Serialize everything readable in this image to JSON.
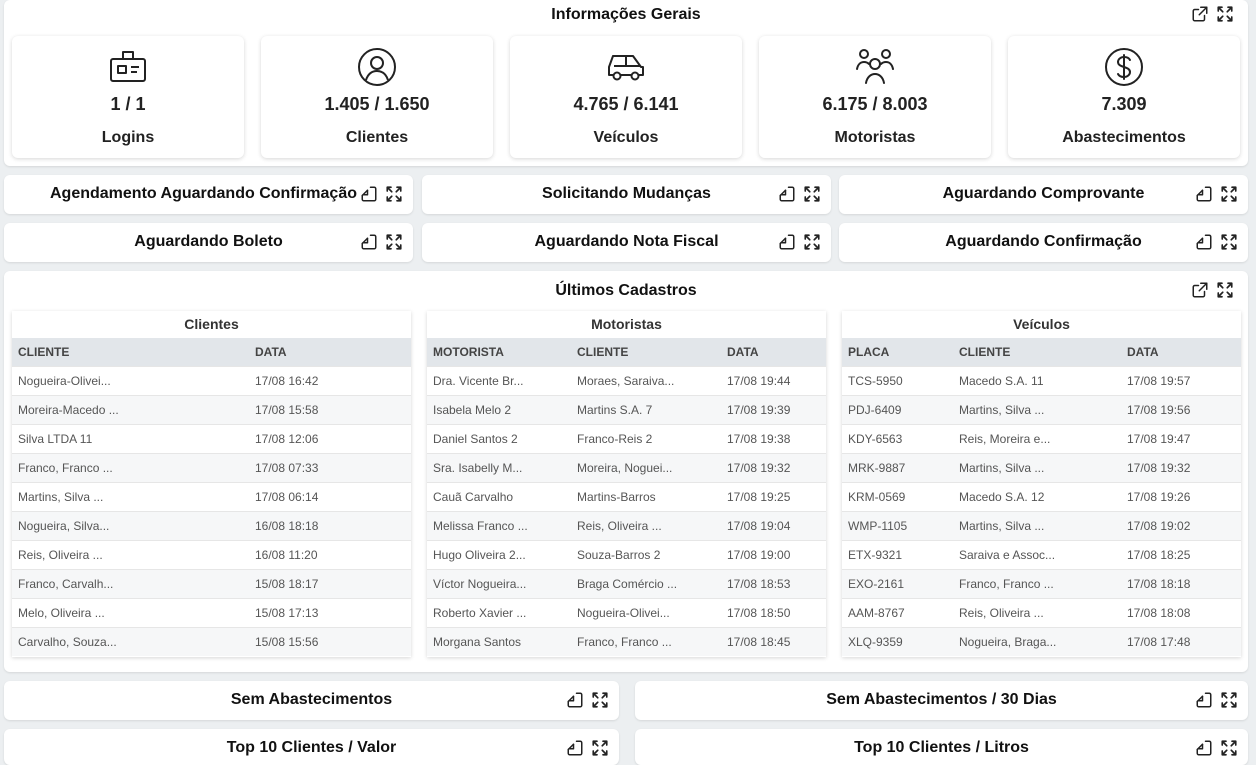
{
  "general": {
    "title": "Informações Gerais",
    "cards": [
      {
        "icon": "id-badge-icon",
        "value": "1 / 1",
        "label": "Logins"
      },
      {
        "icon": "user-circle-icon",
        "value": "1.405 / 1.650",
        "label": "Clientes"
      },
      {
        "icon": "car-icon",
        "value": "4.765 / 6.141",
        "label": "Veículos"
      },
      {
        "icon": "users-icon",
        "value": "6.175 / 8.003",
        "label": "Motoristas"
      },
      {
        "icon": "dollar-circle-icon",
        "value": "7.309",
        "label": "Abastecimentos"
      }
    ]
  },
  "widgets": {
    "agendamento": "Agendamento Aguardando Confirmação",
    "solicitando": "Solicitando Mudanças",
    "aguardando_comprovante": "Aguardando Comprovante",
    "aguardando_boleto": "Aguardando Boleto",
    "aguardando_nota": "Aguardando Nota Fiscal",
    "aguardando_confirmacao": "Aguardando Confirmação",
    "sem_abastecimentos": "Sem Abastecimentos",
    "sem_abastecimentos_30": "Sem Abastecimentos / 30 Dias",
    "top10_valor": "Top 10 Clientes / Valor",
    "top10_litros": "Top 10 Clientes / Litros"
  },
  "recent": {
    "title": "Últimos Cadastros",
    "clientes": {
      "title": "Clientes",
      "headers": [
        "CLIENTE",
        "DATA"
      ],
      "rows": [
        [
          "Nogueira-Olivei...",
          "17/08 16:42"
        ],
        [
          "Moreira-Macedo ...",
          "17/08 15:58"
        ],
        [
          "Silva LTDA 11",
          "17/08 12:06"
        ],
        [
          "Franco, Franco ...",
          "17/08 07:33"
        ],
        [
          "Martins, Silva ...",
          "17/08 06:14"
        ],
        [
          "Nogueira, Silva...",
          "16/08 18:18"
        ],
        [
          "Reis, Oliveira ...",
          "16/08 11:20"
        ],
        [
          "Franco, Carvalh...",
          "15/08 18:17"
        ],
        [
          "Melo, Oliveira ...",
          "15/08 17:13"
        ],
        [
          "Carvalho, Souza...",
          "15/08 15:56"
        ]
      ]
    },
    "motoristas": {
      "title": "Motoristas",
      "headers": [
        "MOTORISTA",
        "CLIENTE",
        "DATA"
      ],
      "rows": [
        [
          "Dra. Vicente Br...",
          "Moraes, Saraiva...",
          "17/08 19:44"
        ],
        [
          "Isabela Melo 2",
          "Martins S.A. 7",
          "17/08 19:39"
        ],
        [
          "Daniel Santos 2",
          "Franco-Reis 2",
          "17/08 19:38"
        ],
        [
          "Sra. Isabelly M...",
          "Moreira, Noguei...",
          "17/08 19:32"
        ],
        [
          "Cauã Carvalho",
          "Martins-Barros",
          "17/08 19:25"
        ],
        [
          "Melissa Franco ...",
          "Reis, Oliveira ...",
          "17/08 19:04"
        ],
        [
          "Hugo Oliveira 2...",
          "Souza-Barros 2",
          "17/08 19:00"
        ],
        [
          "Víctor Nogueira...",
          "Braga Comércio ...",
          "17/08 18:53"
        ],
        [
          "Roberto Xavier ...",
          "Nogueira-Olivei...",
          "17/08 18:50"
        ],
        [
          "Morgana Santos",
          "Franco, Franco ...",
          "17/08 18:45"
        ]
      ]
    },
    "veiculos": {
      "title": "Veículos",
      "headers": [
        "PLACA",
        "CLIENTE",
        "DATA"
      ],
      "rows": [
        [
          "TCS-5950",
          "Macedo S.A. 11",
          "17/08 19:57"
        ],
        [
          "PDJ-6409",
          "Martins, Silva ...",
          "17/08 19:56"
        ],
        [
          "KDY-6563",
          "Reis, Moreira e...",
          "17/08 19:47"
        ],
        [
          "MRK-9887",
          "Martins, Silva ...",
          "17/08 19:32"
        ],
        [
          "KRM-0569",
          "Macedo S.A. 12",
          "17/08 19:26"
        ],
        [
          "WMP-1105",
          "Martins, Silva ...",
          "17/08 19:02"
        ],
        [
          "ETX-9321",
          "Saraiva e Assoc...",
          "17/08 18:25"
        ],
        [
          "EXO-2161",
          "Franco, Franco ...",
          "17/08 18:18"
        ],
        [
          "AAM-8767",
          "Reis, Oliveira ...",
          "17/08 18:08"
        ],
        [
          "XLQ-9359",
          "Nogueira, Braga...",
          "17/08 17:48"
        ]
      ]
    }
  }
}
